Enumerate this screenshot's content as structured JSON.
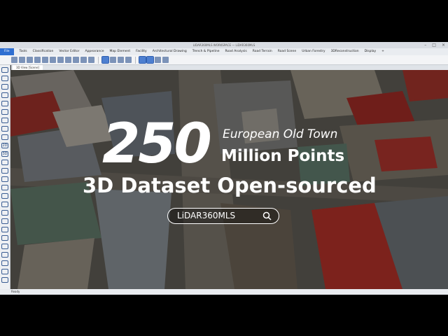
{
  "window": {
    "title": "LIDAR360MLS WORKSPACE — LiDAR360MLS"
  },
  "menubar": {
    "file": "File",
    "items": [
      "Tools",
      "Classification",
      "Vector Editor",
      "Appearance",
      "Map Element",
      "Facility",
      "Architectural Drawing",
      "Trench & Pipeline",
      "Road Analysis",
      "Road Terrain",
      "Road Scene",
      "Urban Forestry",
      "3DReconstruction",
      "Display",
      "+"
    ]
  },
  "doc_tab": {
    "label": "3D View [Scene]"
  },
  "side_toolbar": {
    "labels": [
      "2D",
      "3D"
    ]
  },
  "status": {
    "text": "Ready"
  },
  "overlay": {
    "big_number": "250",
    "line1": "European Old Town",
    "line2": "Million Points",
    "headline": "3D Dataset Open-sourced",
    "search_text": "LiDAR360MLS"
  },
  "colors": {
    "menu_accent": "#2f6fd1",
    "roof_red": "#c9302c",
    "overlay_dim": "#000000"
  },
  "icons": [
    "search-icon",
    "minimize-icon",
    "maximize-icon",
    "close-icon"
  ]
}
